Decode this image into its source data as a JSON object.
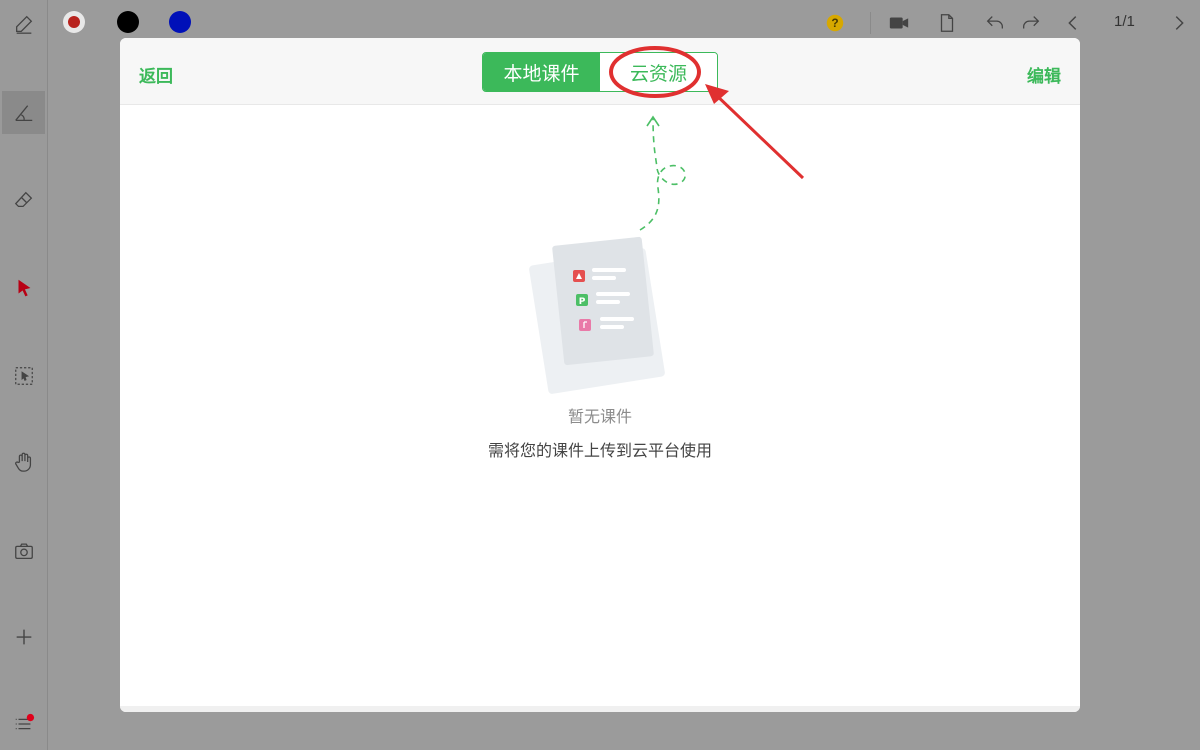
{
  "toolbar": {
    "colors": [
      "#b8231e",
      "#000000",
      "#0010b8"
    ],
    "page_indicator": "1/1",
    "help_badge_color": "#d7a800",
    "icons": [
      "pen-icon",
      "help-icon",
      "video-camera-icon",
      "document-icon",
      "undo-icon",
      "redo-icon",
      "chevron-left-icon",
      "chevron-right-icon"
    ]
  },
  "sidebar": {
    "tools": [
      "pen-icon",
      "shapes-icon",
      "eraser-icon",
      "pointer-icon",
      "selection-icon",
      "hand-icon",
      "camera-icon",
      "plus-icon",
      "menu-icon"
    ],
    "pointer_color": "#b80014",
    "notification_dot_color": "#e0001b"
  },
  "modal": {
    "back_label": "返回",
    "edit_label": "编辑",
    "tabs": [
      {
        "label": "本地课件",
        "active": true
      },
      {
        "label": "云资源",
        "active": false
      }
    ],
    "accent_color": "#3cb95a",
    "empty_title": "暂无课件",
    "empty_desc": "需将您的课件上传到云平台使用"
  },
  "annotation": {
    "highlight_color": "#e03030"
  }
}
